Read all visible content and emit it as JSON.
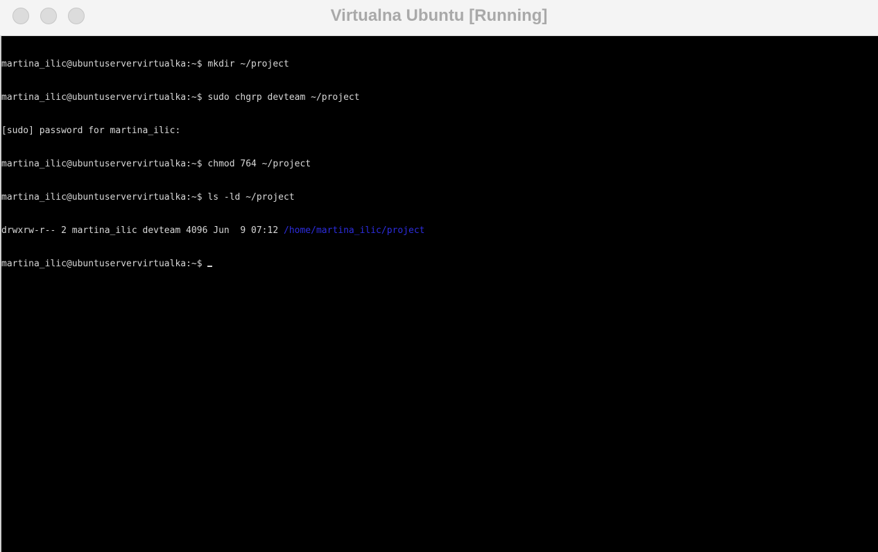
{
  "window": {
    "title": "Virtualna Ubuntu [Running]"
  },
  "colors": {
    "terminal_bg": "#000000",
    "terminal_fg": "#d8d8d8",
    "link_blue": "#2d2de0",
    "title_text": "#a9a9a9"
  },
  "terminal": {
    "lines": [
      {
        "text": "martina_ilic@ubuntuservervirtualka:~$ mkdir ~/project"
      },
      {
        "text": "martina_ilic@ubuntuservervirtualka:~$ sudo chgrp devteam ~/project"
      },
      {
        "text": "[sudo] password for martina_ilic:"
      },
      {
        "text": "martina_ilic@ubuntuservervirtualka:~$ chmod 764 ~/project"
      },
      {
        "text": "martina_ilic@ubuntuservervirtualka:~$ ls -ld ~/project"
      },
      {
        "text": "drwxrw-r-- 2 martina_ilic devteam 4096 Jun  9 07:12 ",
        "link": "/home/martina_ilic/project"
      },
      {
        "text": "martina_ilic@ubuntuservervirtualka:~$ "
      }
    ]
  },
  "icons": {
    "close": "close-button-icon",
    "minimize": "minimize-button-icon",
    "zoom": "zoom-button-icon",
    "cursor": "text-cursor-icon"
  }
}
